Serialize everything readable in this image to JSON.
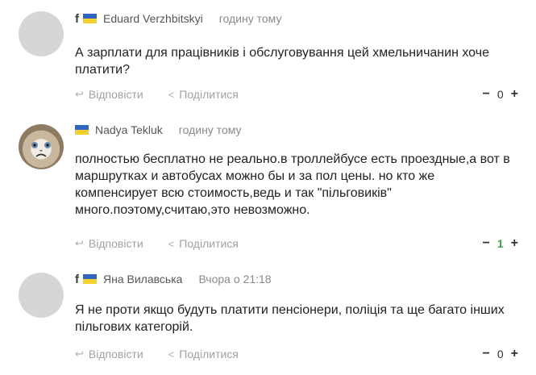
{
  "comments": [
    {
      "has_fb": true,
      "author": "Eduard Verzhbitskyi",
      "time": "годину тому",
      "text": "А зарплати для працівників і обслуговування цей хмельничанин хоче платити?",
      "reply_label": "Відповісти",
      "share_label": "Поділитися",
      "score": "0"
    },
    {
      "has_fb": false,
      "author": "Nadya Tekluk",
      "time": "годину тому",
      "text": "полностью бесплатно не реально.в троллейбусе есть проездные,а вот в маршрутках и автобусах можно бы и за пол цены. но кто же компенсирует всю стоимость,ведь и так \"пільговиків\" много.поэтому,считаю,это невозможно.",
      "reply_label": "Відповісти",
      "share_label": "Поділитися",
      "score": "1"
    },
    {
      "has_fb": true,
      "author": "Яна Вилавська",
      "time": "Вчора о 21:18",
      "text": "Я не проти якщо будуть платити пенсіонери, поліція та ще багато інших пільгових категорій.",
      "reply_label": "Відповісти",
      "share_label": "Поділитися",
      "score": "0"
    }
  ],
  "icons": {
    "facebook": "f",
    "reply": "↩",
    "share": "<",
    "minus": "−",
    "plus": "+"
  },
  "colors": {
    "flag_blue": "#2f66c4",
    "flag_yellow": "#f5cf2a",
    "positive_score": "#3aa23a"
  }
}
